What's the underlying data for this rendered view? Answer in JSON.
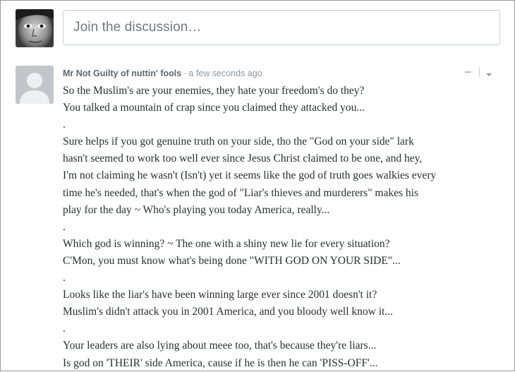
{
  "compose": {
    "placeholder": "Join the discussion…"
  },
  "comment": {
    "author": "Mr Not Guilty of nuttin' fools",
    "separator": "·",
    "timestamp": "a few seconds ago",
    "collapse_label": "−",
    "lines": [
      "So the Muslim's are your enemies, they hate your freedom's do they?",
      "You talked a mountain of crap since you claimed they attacked you...",
      ".",
      "Sure helps if you got genuine truth on your side, tho the \"God on your side\" lark",
      "hasn't seemed to work too well ever since Jesus Christ claimed to be one, and hey,",
      "I'm not claiming he wasn't (Isn't) yet it seems like the god of truth goes walkies every",
      "time he's needed, that's when the god of \"Liar's thieves and murderers\" makes his",
      "play for the day ~ Who's playing you today America, really...",
      ".",
      "Which god is winning? ~ The one with a shiny new lie for every situation?",
      "C'Mon, you must know what's being done \"WITH GOD ON YOUR SIDE\"...",
      ".",
      "Looks like the liar's have been winning large ever since 2001 doesn't it?",
      "Muslim's didn't attack you in 2001 America, and you bloody well know it...",
      ".",
      "Your leaders are also lying about meee too, that's because they're liars...",
      "Is god on 'THEIR' side America, cause if he is then he can 'PISS-OFF'..."
    ]
  },
  "icons": {
    "user_avatar": "user-photo-avatar",
    "comment_avatar": "default-person-avatar",
    "options": "chevron-down-icon"
  },
  "colors": {
    "author": "#5b6873",
    "meta": "#8a97a2",
    "body_text": "#2a2e2e",
    "placeholder": "#6f7a83",
    "border": "#c8cdd2",
    "avatar_placeholder": "#c2c6ca"
  }
}
